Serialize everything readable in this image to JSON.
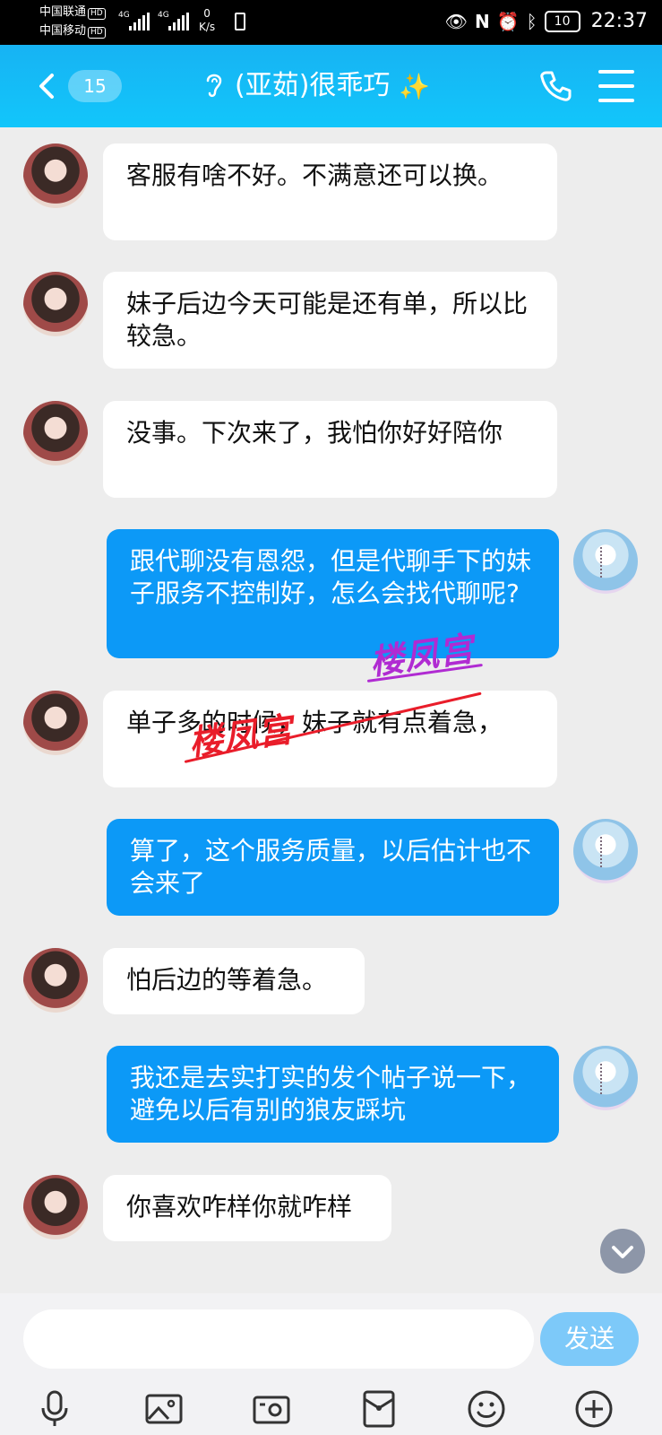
{
  "status_bar": {
    "carrier1": "中国联通",
    "carrier2": "中国移动",
    "hd": "HD",
    "net_tag1": "4G",
    "net_tag2": "4G",
    "net_speed_value": "0",
    "net_speed_unit": "K/s",
    "battery": "10",
    "time": "22:37"
  },
  "header": {
    "unread_count": "15",
    "title": "(亚茹)很乖巧",
    "title_emoji": "✨"
  },
  "messages": [
    {
      "side": "in",
      "text": "客服有啥不好。不满意还可以换。"
    },
    {
      "side": "in",
      "text": "妹子后边今天可能是还有单，所以比较急。"
    },
    {
      "side": "in",
      "text": "没事。下次来了，我怕你好好陪你"
    },
    {
      "side": "out",
      "text": "跟代聊没有恩怨，但是代聊手下的妹子服务不控制好，怎么会找代聊呢?"
    },
    {
      "side": "in",
      "text": "单子多的时候，妹子就有点着急，"
    },
    {
      "side": "out",
      "text": "算了，这个服务质量，以后估计也不会来了"
    },
    {
      "side": "in",
      "text": "怕后边的等着急。"
    },
    {
      "side": "out",
      "text": "我还是去实打实的发个帖子说一下，避免以后有别的狼友踩坑"
    },
    {
      "side": "in",
      "text": "你喜欢咋样你就咋样"
    }
  ],
  "watermarks": {
    "text1": "楼凤宫",
    "text2": "楼凤宫"
  },
  "input": {
    "placeholder": "",
    "value": "",
    "send_label": "发送"
  },
  "toolbar": [
    "microphone-icon",
    "image-icon",
    "camera-icon",
    "red-packet-icon",
    "emoji-icon",
    "plus-icon"
  ]
}
